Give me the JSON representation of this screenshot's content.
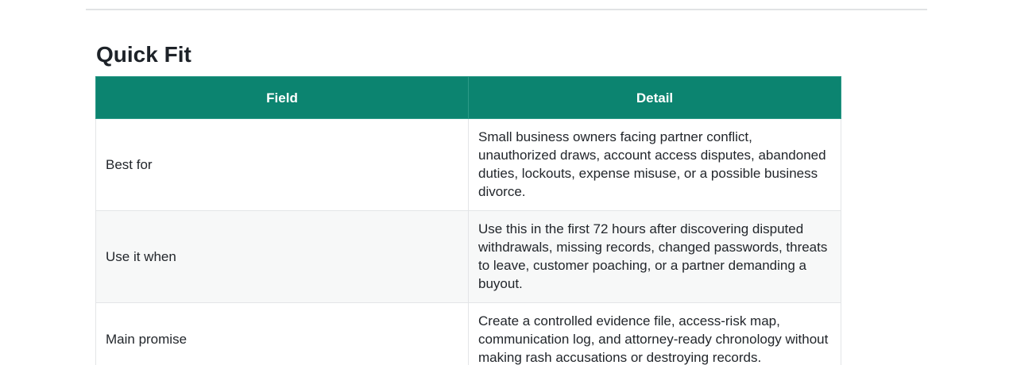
{
  "section": {
    "title": "Quick Fit"
  },
  "table": {
    "headers": [
      "Field",
      "Detail"
    ],
    "rows": [
      {
        "field": "Best for",
        "detail": "Small business owners facing partner conflict, unauthorized draws, account access disputes, abandoned duties, lockouts, expense misuse, or a possible business divorce."
      },
      {
        "field": "Use it when",
        "detail": "Use this in the first 72 hours after discovering disputed withdrawals, missing records, changed passwords, threats to leave, customer poaching, or a partner demanding a buyout."
      },
      {
        "field": "Main promise",
        "detail": "Create a controlled evidence file, access-risk map, communication log, and attorney-ready chronology without making rash accusations or destroying records."
      }
    ]
  }
}
